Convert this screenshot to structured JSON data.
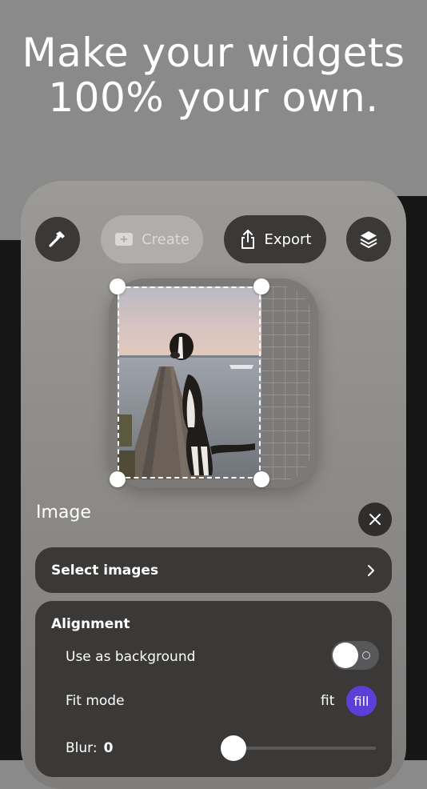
{
  "headline": {
    "line1": "Make your widgets",
    "line2": "100% your own."
  },
  "toolbar": {
    "build_icon": "hammer-icon",
    "create_label": "Create",
    "create_icon": "plus-square-icon",
    "export_label": "Export",
    "export_icon": "share-icon",
    "layers_icon": "layers-icon"
  },
  "editor": {
    "section_title": "Image",
    "close_icon": "close-icon",
    "select_images_label": "Select images",
    "select_images_icon": "chevron-right-icon",
    "alignment": {
      "title": "Alignment",
      "use_as_background_label": "Use as background",
      "use_as_background_on": false,
      "fit_mode_label": "Fit mode",
      "fit_option": "fit",
      "fill_option": "fill",
      "selected_fit_mode": "fill",
      "blur_label": "Blur:",
      "blur_value": "0"
    }
  },
  "colors": {
    "accent": "#5b3fd9",
    "button_dark": "#3a3937",
    "background": "#8a8a8a"
  }
}
